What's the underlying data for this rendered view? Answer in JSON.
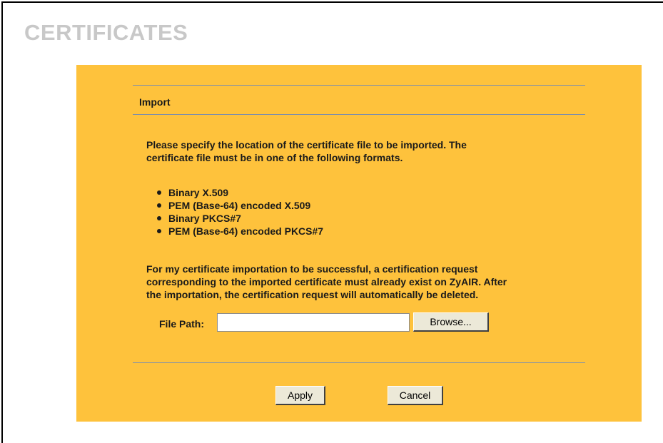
{
  "page": {
    "title": "CERTIFICATES"
  },
  "section": {
    "title": "Import"
  },
  "intro": {
    "line1": "Please specify the location of the certificate file to be imported. The",
    "line2": "certificate file must be in one of the following formats."
  },
  "formats": [
    "Binary X.509",
    "PEM (Base-64) encoded X.509",
    "Binary PKCS#7",
    "PEM (Base-64) encoded PKCS#7"
  ],
  "note": {
    "line1": "For my certificate importation to be successful, a certification request",
    "line2": "corresponding to the imported certificate must already exist on ZyAIR. After",
    "line3": "the importation, the certification request will automatically be deleted."
  },
  "file_path": {
    "label": "File Path:",
    "value": "",
    "browse_label": "Browse..."
  },
  "actions": {
    "apply_label": "Apply",
    "cancel_label": "Cancel"
  },
  "colors": {
    "panel": "#fec23c",
    "rule": "#7d8fab",
    "title": "#c8c8c8"
  }
}
